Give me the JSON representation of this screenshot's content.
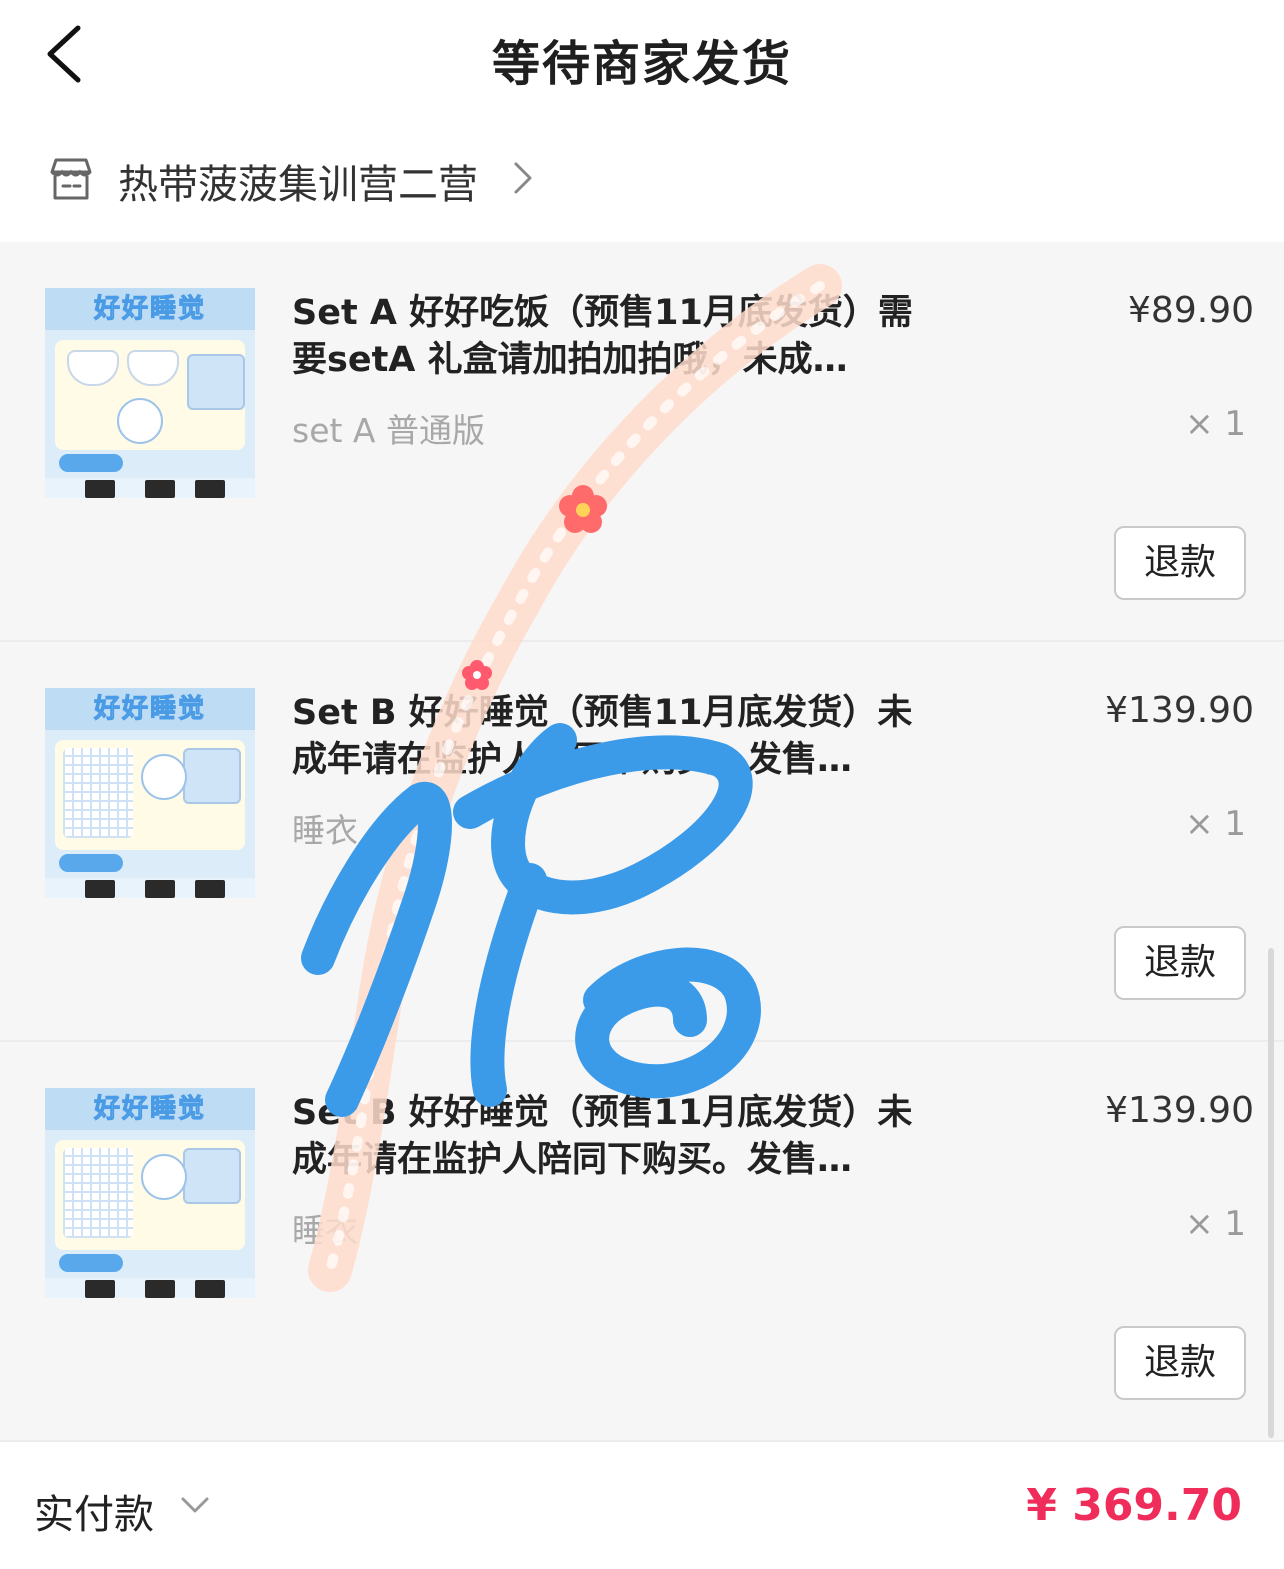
{
  "header": {
    "title": "等待商家发货",
    "back_icon": "chevron-left-icon"
  },
  "shop": {
    "name": "热带菠菠集训营二营",
    "icon": "store-icon",
    "chevron_icon": "chevron-right-icon"
  },
  "items": [
    {
      "title": "Set A 好好吃饭（预售11月底发货）需要setA 礼盒请加拍加拍哦，未成…",
      "sku": "set A 普通版",
      "price": "¥89.90",
      "qty": "× 1",
      "refund_label": "退款",
      "thumb_banner": "好好睡觉"
    },
    {
      "title": "Set B 好好睡觉（预售11月底发货）未成年请在监护人陪同下购买。发售…",
      "sku": "睡衣",
      "price": "¥139.90",
      "qty": "× 1",
      "refund_label": "退款",
      "thumb_banner": "好好睡觉"
    },
    {
      "title": "Set B 好好睡觉（预售11月底发货）未成年请在监护人陪同下购买。发售…",
      "sku": "睡衣",
      "price": "¥139.90",
      "qty": "× 1",
      "refund_label": "退款",
      "thumb_banner": "好好睡觉"
    }
  ],
  "footer": {
    "pay_label": "实付款",
    "pay_amount": "¥ 369.70",
    "chevron_icon": "chevron-down-icon"
  },
  "colors": {
    "accent": "#f02d5a",
    "doodle_blue": "#3a9ae8",
    "doodle_peach": "#ffd9c9",
    "page_bg": "#f6f6f6"
  }
}
